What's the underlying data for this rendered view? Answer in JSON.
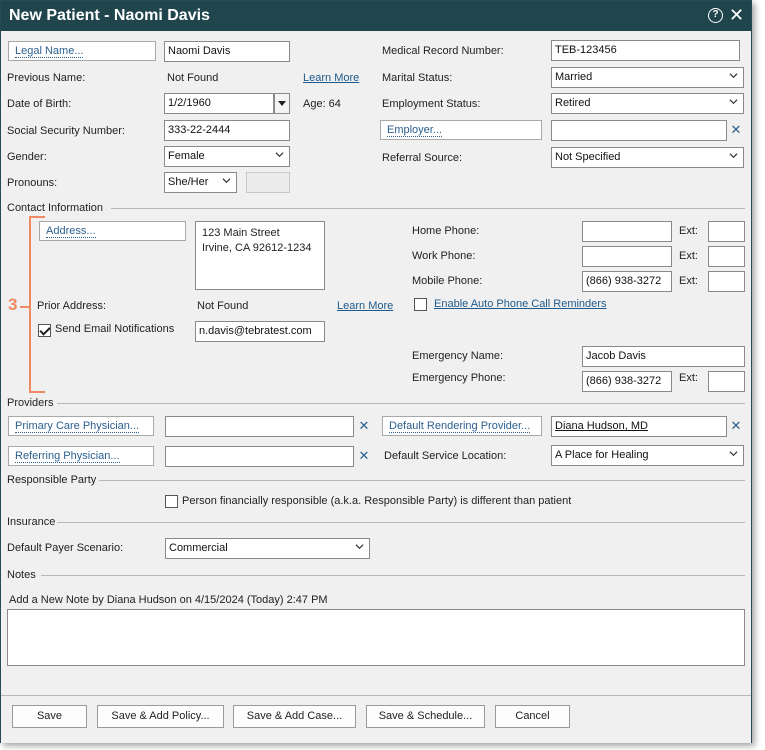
{
  "window": {
    "title": "New Patient - Naomi Davis"
  },
  "patient": {
    "legal_name_btn": "Legal Name...",
    "legal_name": "Naomi Davis",
    "previous_name_label": "Previous Name:",
    "previous_name": "Not Found",
    "learn_more": "Learn More",
    "dob_label": "Date of Birth:",
    "dob": "1/2/1960",
    "age": "Age: 64",
    "ssn_label": "Social Security Number:",
    "ssn": "333-22-2444",
    "gender_label": "Gender:",
    "gender": "Female",
    "pronouns_label": "Pronouns:",
    "pronouns": "She/Her"
  },
  "right": {
    "mrn_label": "Medical Record Number:",
    "mrn": "TEB-123456",
    "marital_label": "Marital Status:",
    "marital": "Married",
    "employment_label": "Employment Status:",
    "employment": "Retired",
    "employer_btn": "Employer...",
    "employer": "",
    "referral_label": "Referral Source:",
    "referral": "Not Specified"
  },
  "contact": {
    "section": "Contact Information",
    "callout": "3",
    "address_btn": "Address...",
    "address_line1": "123 Main Street",
    "address_line2": "Irvine, CA 92612-1234",
    "prior_address_label": "Prior Address:",
    "prior_address": "Not Found",
    "learn_more": "Learn More",
    "send_email_label": "Send Email Notifications",
    "email": "n.davis@tebratest.com",
    "home_phone_label": "Home Phone:",
    "work_phone_label": "Work Phone:",
    "mobile_phone_label": "Mobile Phone:",
    "mobile_phone": "(866) 938-3272",
    "ext_label": "Ext:",
    "auto_reminders": "Enable Auto Phone Call Reminders",
    "emergency_name_label": "Emergency Name:",
    "emergency_name": "Jacob Davis",
    "emergency_phone_label": "Emergency Phone:",
    "emergency_phone": "(866) 938-3272"
  },
  "providers": {
    "section": "Providers",
    "pcp_btn": "Primary Care Physician...",
    "referring_btn": "Referring Physician...",
    "rendering_btn": "Default Rendering Provider...",
    "rendering": "Diana Hudson, MD",
    "service_location_label": "Default Service Location:",
    "service_location": "A Place for Healing"
  },
  "responsible": {
    "section": "Responsible Party",
    "checkbox_label": "Person financially responsible (a.k.a. Responsible Party) is different than patient"
  },
  "insurance": {
    "section": "Insurance",
    "payer_label": "Default Payer Scenario:",
    "payer": "Commercial"
  },
  "notes": {
    "section": "Notes",
    "add_note_label": "Add a New Note by Diana Hudson on 4/15/2024 (Today) 2:47 PM",
    "note_text": ""
  },
  "footer": {
    "save": "Save",
    "save_add_policy": "Save & Add Policy...",
    "save_add_case": "Save & Add Case...",
    "save_schedule": "Save & Schedule...",
    "cancel": "Cancel"
  }
}
